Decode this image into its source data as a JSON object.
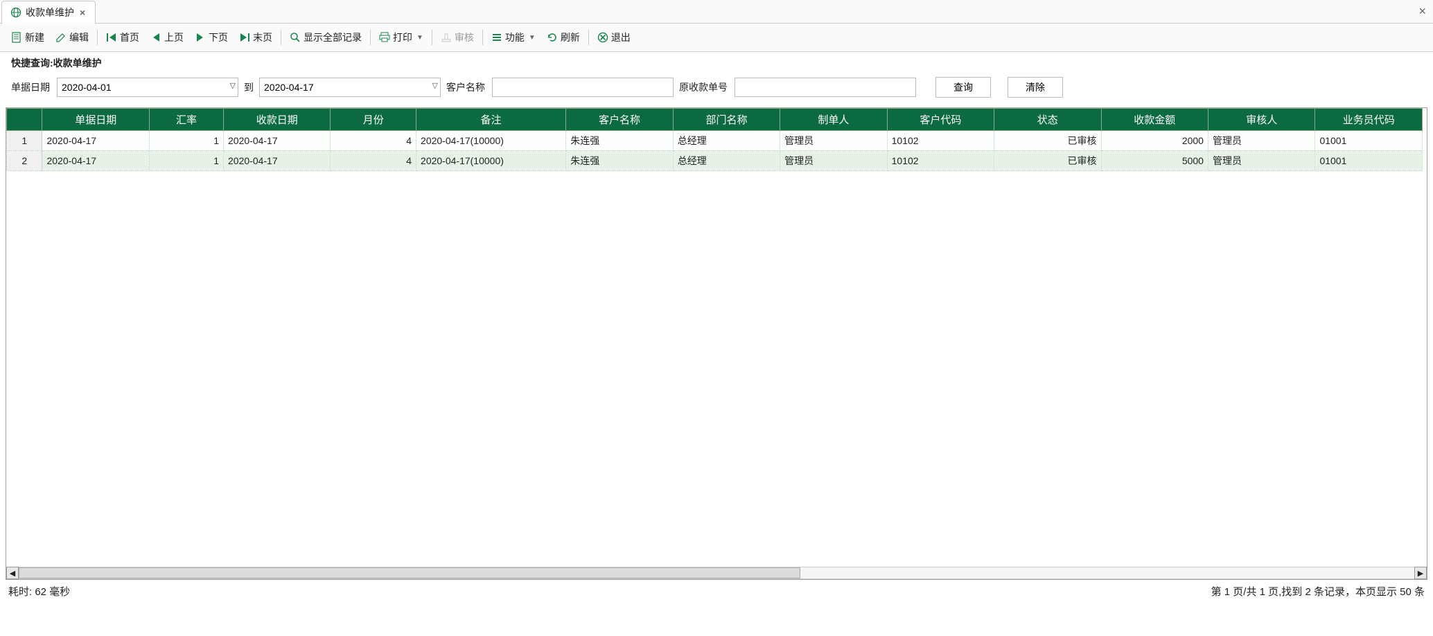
{
  "tab": {
    "title": "收款单维护"
  },
  "toolbar": {
    "new": "新建",
    "edit": "编辑",
    "first": "首页",
    "prev": "上页",
    "next": "下页",
    "last": "末页",
    "showAll": "显示全部记录",
    "print": "打印",
    "audit": "审核",
    "func": "功能",
    "refresh": "刷新",
    "exit": "退出"
  },
  "quickQueryLabel": "快捷查询:收款单维护",
  "filters": {
    "dateLabel": "单据日期",
    "toLabel": "到",
    "dateFrom": "2020-04-01",
    "dateTo": "2020-04-17",
    "custLabel": "客户名称",
    "custValue": "",
    "origNoLabel": "原收款单号",
    "origNoValue": "",
    "queryBtn": "查询",
    "clearBtn": "清除"
  },
  "columns": [
    "单据日期",
    "汇率",
    "收款日期",
    "月份",
    "备注",
    "客户名称",
    "部门名称",
    "制单人",
    "客户代码",
    "状态",
    "收款金额",
    "审核人",
    "业务员代码"
  ],
  "rows": [
    {
      "idx": "1",
      "date": "2020-04-17",
      "rate": "1",
      "recvDate": "2020-04-17",
      "month": "4",
      "remark": "2020-04-17(10000)",
      "cust": "朱连强",
      "dept": "总经理",
      "maker": "管理员",
      "custCode": "10102",
      "status": "已审核",
      "amount": "2000",
      "auditor": "管理员",
      "salesman": "01001"
    },
    {
      "idx": "2",
      "date": "2020-04-17",
      "rate": "1",
      "recvDate": "2020-04-17",
      "month": "4",
      "remark": "2020-04-17(10000)",
      "cust": "朱连强",
      "dept": "总经理",
      "maker": "管理员",
      "custCode": "10102",
      "status": "已审核",
      "amount": "5000",
      "auditor": "管理员",
      "salesman": "01001"
    }
  ],
  "status": {
    "left": "耗时: 62 毫秒",
    "right": "第 1 页/共 1 页,找到 2 条记录，本页显示 50 条"
  }
}
